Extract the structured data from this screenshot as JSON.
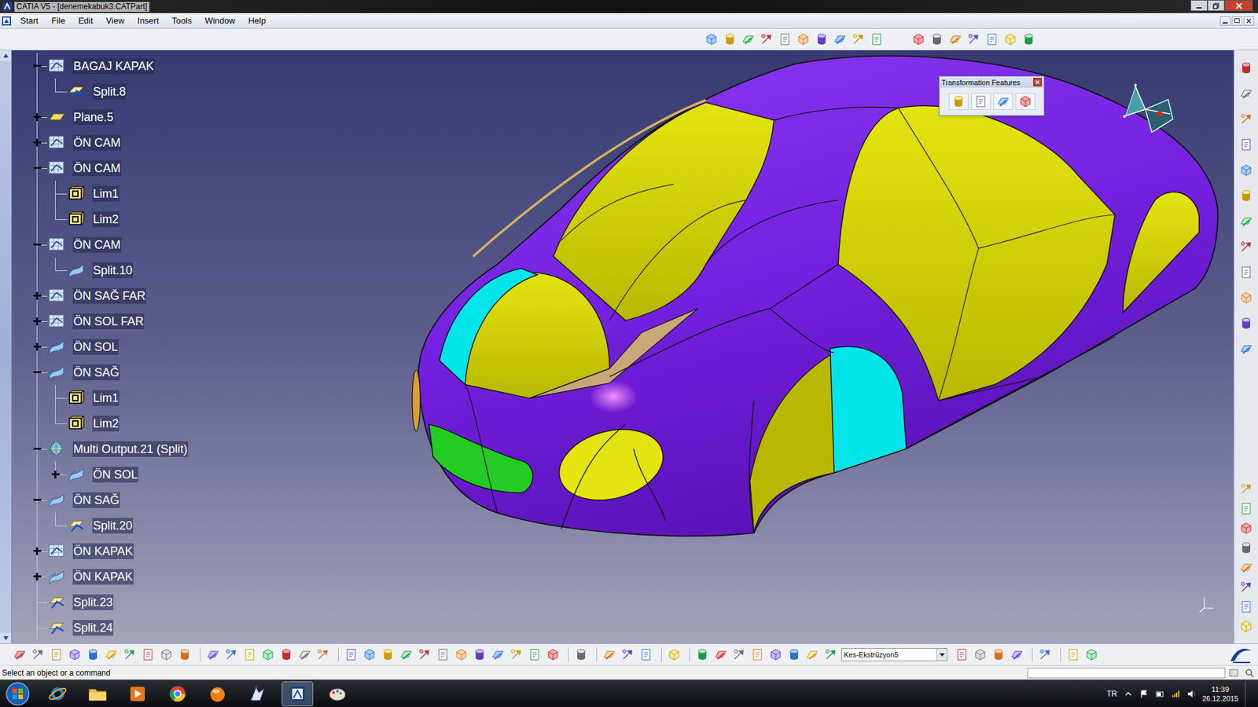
{
  "window": {
    "title": "CATIA V5 - [denemekabuk3.CATPart]"
  },
  "menu": [
    "Start",
    "File",
    "Edit",
    "View",
    "Insert",
    "Tools",
    "Window",
    "Help"
  ],
  "tree": [
    {
      "label": "BAGAJ KAPAK",
      "level": 0,
      "kind": "geoset",
      "expandable": true,
      "expanded": true
    },
    {
      "label": "Split.8",
      "level": 1,
      "kind": "split",
      "expandable": false,
      "expanded": false
    },
    {
      "label": "Plane.5",
      "level": 0,
      "kind": "plane",
      "expandable": true,
      "expanded": false
    },
    {
      "label": "ÖN CAM",
      "level": 0,
      "kind": "geoset",
      "expandable": true,
      "expanded": false
    },
    {
      "label": "ÖN CAM",
      "level": 0,
      "kind": "geoset",
      "expandable": true,
      "expanded": true
    },
    {
      "label": "Lim1",
      "level": 1,
      "kind": "body",
      "expandable": false,
      "expanded": false
    },
    {
      "label": "Lim2",
      "level": 1,
      "kind": "body",
      "expandable": false,
      "expanded": false
    },
    {
      "label": "ÖN CAM",
      "level": 0,
      "kind": "geoset",
      "expandable": true,
      "expanded": true
    },
    {
      "label": "Split.10",
      "level": 1,
      "kind": "surface",
      "expandable": false,
      "expanded": false
    },
    {
      "label": "ÖN SAĞ FAR",
      "level": 0,
      "kind": "geoset",
      "expandable": true,
      "expanded": false
    },
    {
      "label": "ÖN SOL FAR",
      "level": 0,
      "kind": "geoset",
      "expandable": true,
      "expanded": false
    },
    {
      "label": "ÖN SOL",
      "level": 0,
      "kind": "surface",
      "expandable": true,
      "expanded": false
    },
    {
      "label": "ÖN SAĞ",
      "level": 0,
      "kind": "surface",
      "expandable": true,
      "expanded": true
    },
    {
      "label": "Lim1",
      "level": 1,
      "kind": "body",
      "expandable": false,
      "expanded": false
    },
    {
      "label": "Lim2",
      "level": 1,
      "kind": "body",
      "expandable": false,
      "expanded": false
    },
    {
      "label": "Multi Output.21 (Split)",
      "level": 0,
      "kind": "multioutput",
      "expandable": true,
      "expanded": true
    },
    {
      "label": "ÖN SOL",
      "level": 1,
      "kind": "surface",
      "expandable": true,
      "expanded": false
    },
    {
      "label": "ÖN SAĞ",
      "level": 0,
      "kind": "surface",
      "expandable": true,
      "expanded": true
    },
    {
      "label": "Split.20",
      "level": 1,
      "kind": "split",
      "expandable": false,
      "expanded": false
    },
    {
      "label": "ÖN KAPAK",
      "level": 0,
      "kind": "geoset",
      "expandable": true,
      "expanded": false
    },
    {
      "label": "ÖN KAPAK",
      "level": 0,
      "kind": "surface",
      "expandable": true,
      "expanded": false
    },
    {
      "label": "Split.23",
      "level": 0,
      "kind": "split",
      "expandable": false,
      "expanded": false
    },
    {
      "label": "Split.24",
      "level": 0,
      "kind": "split",
      "expandable": false,
      "expanded": false
    }
  ],
  "floating_toolbar": {
    "title": "Transformation Features"
  },
  "dropdown": {
    "value": "Kes-Ekstrüzyon5"
  },
  "status_bar": {
    "text": "Select an object or a command"
  },
  "taskbar": {
    "language": "TR",
    "time": "11:39",
    "date": "26.12.2015"
  }
}
